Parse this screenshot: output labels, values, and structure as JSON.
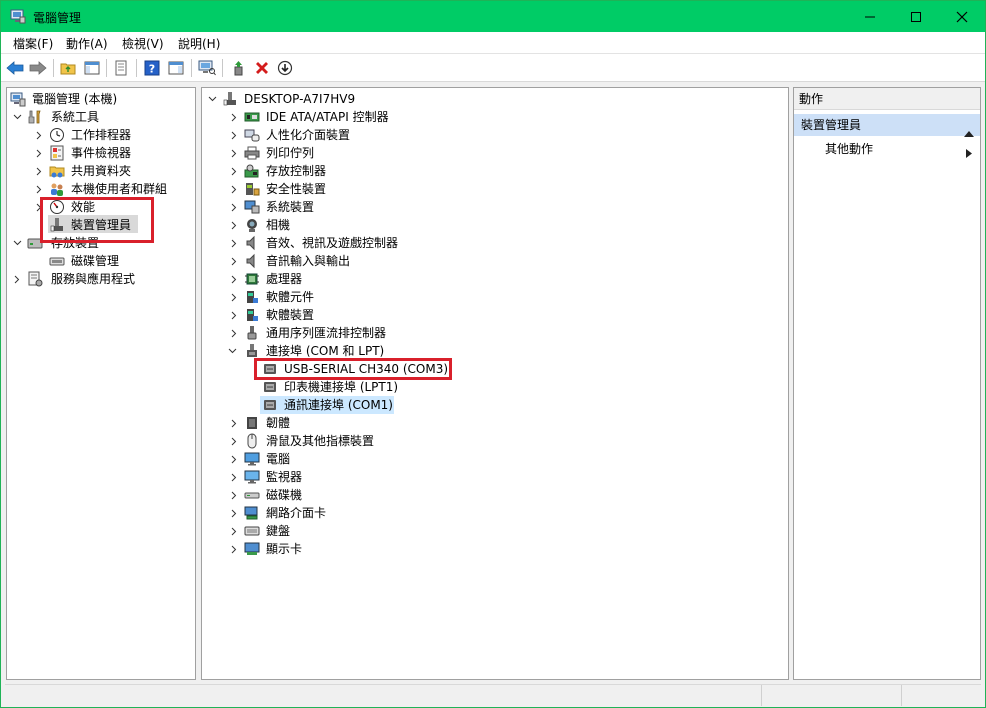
{
  "window": {
    "title": "電腦管理",
    "controls": {
      "minimize": "—",
      "maximize": "☐",
      "close": "✕"
    }
  },
  "menu": [
    {
      "label": "檔案(F)"
    },
    {
      "label": "動作(A)"
    },
    {
      "label": "檢視(V)"
    },
    {
      "label": "說明(H)"
    }
  ],
  "left_tree": {
    "root": "電腦管理 (本機)",
    "system_tools": "系統工具",
    "system_children": [
      "工作排程器",
      "事件檢視器",
      "共用資料夾",
      "本機使用者和群組",
      "效能",
      "裝置管理員"
    ],
    "storage": "存放裝置",
    "storage_children": [
      "磁碟管理"
    ],
    "services": "服務與應用程式",
    "selected": "裝置管理員"
  },
  "device_tree": {
    "computer": "DESKTOP-A7I7HV9",
    "categories_before_ports": [
      "IDE ATA/ATAPI 控制器",
      "人性化介面裝置",
      "列印佇列",
      "存放控制器",
      "安全性裝置",
      "系統裝置",
      "相機",
      "音效、視訊及遊戲控制器",
      "音訊輸入與輸出",
      "處理器",
      "軟體元件",
      "軟體裝置",
      "通用序列匯流排控制器"
    ],
    "ports_category": "連接埠 (COM 和 LPT)",
    "ports_children": [
      "USB-SERIAL CH340 (COM3)",
      "印表機連接埠 (LPT1)",
      "通訊連接埠 (COM1)"
    ],
    "highlighted_port": "通訊連接埠 (COM1)",
    "categories_after_ports": [
      "韌體",
      "滑鼠及其他指標裝置",
      "電腦",
      "監視器",
      "磁碟機",
      "網路介面卡",
      "鍵盤",
      "顯示卡"
    ]
  },
  "actions": {
    "header": "動作",
    "section": "裝置管理員",
    "items": [
      "其他動作"
    ]
  },
  "colors": {
    "titlebar": "#00cc66",
    "selection": "#d9d9d9",
    "highlight": "#cce8ff",
    "annotation_red": "#d9202b",
    "action_section": "#cde0f7"
  }
}
